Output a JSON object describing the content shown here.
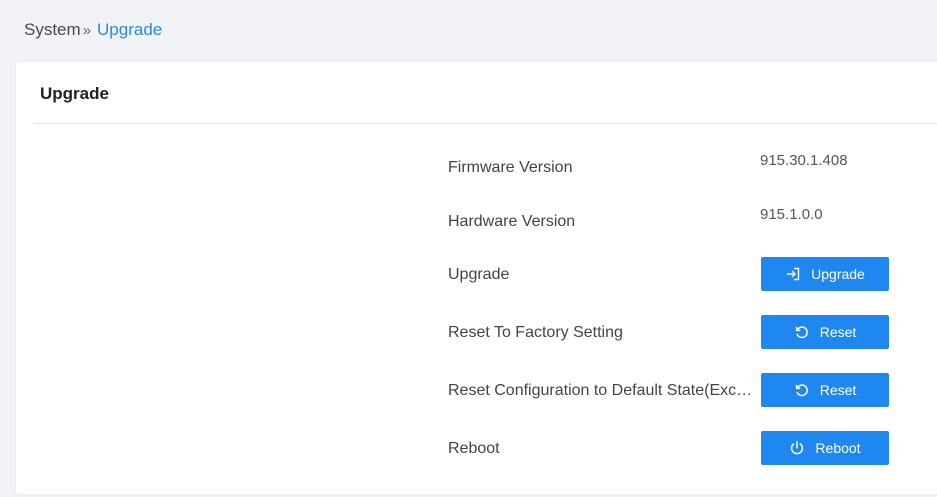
{
  "breadcrumb": {
    "parent": "System",
    "separator": "»",
    "current": "Upgrade"
  },
  "panel": {
    "title": "Upgrade"
  },
  "rows": {
    "firmware": {
      "label": "Firmware Version",
      "value": "915.30.1.408"
    },
    "hardware": {
      "label": "Hardware Version",
      "value": "915.1.0.0"
    },
    "upgrade": {
      "label": "Upgrade",
      "button": "Upgrade",
      "icon": "import-icon"
    },
    "factory_reset": {
      "label": "Reset To Factory Setting",
      "button": "Reset",
      "icon": "reset-icon"
    },
    "config_reset": {
      "label": "Reset Configuration to Default State(Except Data)",
      "button": "Reset",
      "icon": "reset-icon"
    },
    "reboot": {
      "label": "Reboot",
      "button": "Reboot",
      "icon": "power-icon"
    }
  },
  "colors": {
    "accent": "#1e88f0",
    "breadcrumb_current": "#2a8be0",
    "background": "#f0f2f5"
  }
}
